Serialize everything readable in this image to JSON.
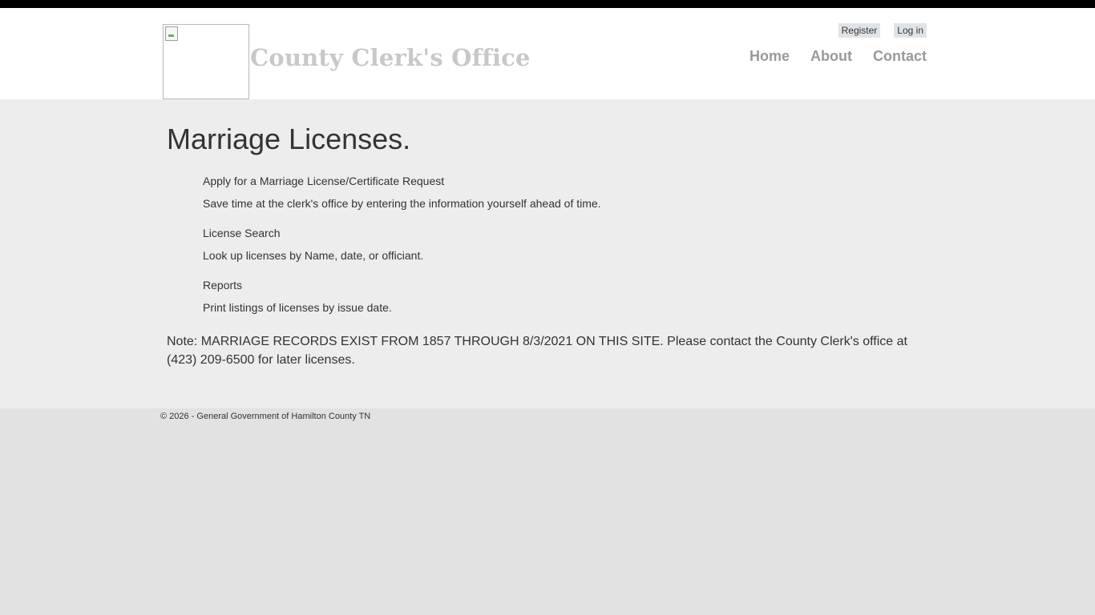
{
  "header": {
    "site_title": "County Clerk's Office",
    "login_links": {
      "register": "Register",
      "login": "Log in"
    },
    "nav": {
      "home": "Home",
      "about": "About",
      "contact": "Contact"
    }
  },
  "main": {
    "heading": "Marriage Licenses.",
    "items": [
      {
        "title": "Apply for a Marriage License/Certificate Request",
        "description": "Save time at the clerk's office by entering the information yourself ahead of time."
      },
      {
        "title": "License Search",
        "description": "Look up licenses by Name, date, or officiant."
      },
      {
        "title": "Reports",
        "description": "Print listings of licenses by issue date."
      }
    ],
    "note": "Note: MARRIAGE RECORDS EXIST FROM 1857 THROUGH 8/3/2021 ON THIS SITE. Please contact the County Clerk's office at (423) 209-6500 for later licenses."
  },
  "footer": {
    "copyright": "© 2026 - General Government of Hamilton County TN"
  },
  "colors": {
    "top_strip": "#000000",
    "header_bg": "#ffffff",
    "content_bg": "#ededed",
    "footer_bg": "#e2e2e2",
    "title_text": "#c8c8c8",
    "nav_text": "#999999",
    "button_bg": "#e1e4e7"
  }
}
